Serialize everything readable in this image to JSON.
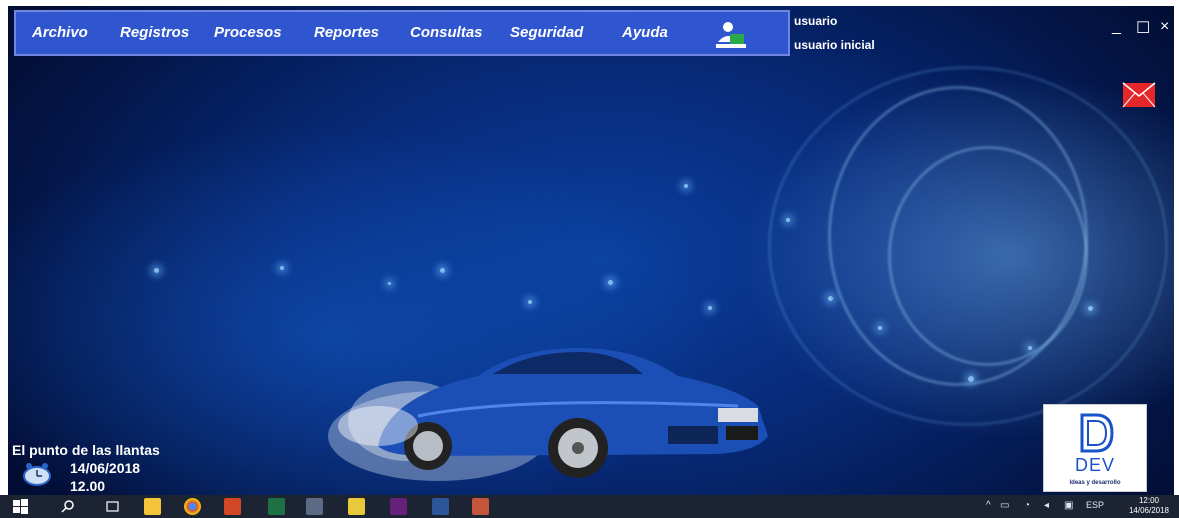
{
  "menu": {
    "items": [
      {
        "label": "Archivo"
      },
      {
        "label": "Registros"
      },
      {
        "label": "Procesos"
      },
      {
        "label": "Reportes"
      },
      {
        "label": "Consultas"
      },
      {
        "label": "Seguridad"
      },
      {
        "label": "Ayuda"
      }
    ]
  },
  "user": {
    "label": "usuario",
    "name": "usuario inicial"
  },
  "window_controls": {
    "minimize": "_",
    "maximize": "☐",
    "close": "×"
  },
  "footer": {
    "company": "El punto de las llantas",
    "date": "14/06/2018",
    "time": "12.00"
  },
  "logo": {
    "text": "DEV",
    "subtitle": "Ideas y desarrollo"
  },
  "taskbar": {
    "language": "ESP",
    "time": "12:00",
    "date": "14/06/2018"
  },
  "colors": {
    "menubar": "#2f55cf",
    "taskbar": "#1c2333",
    "mail": "#e5262a"
  }
}
